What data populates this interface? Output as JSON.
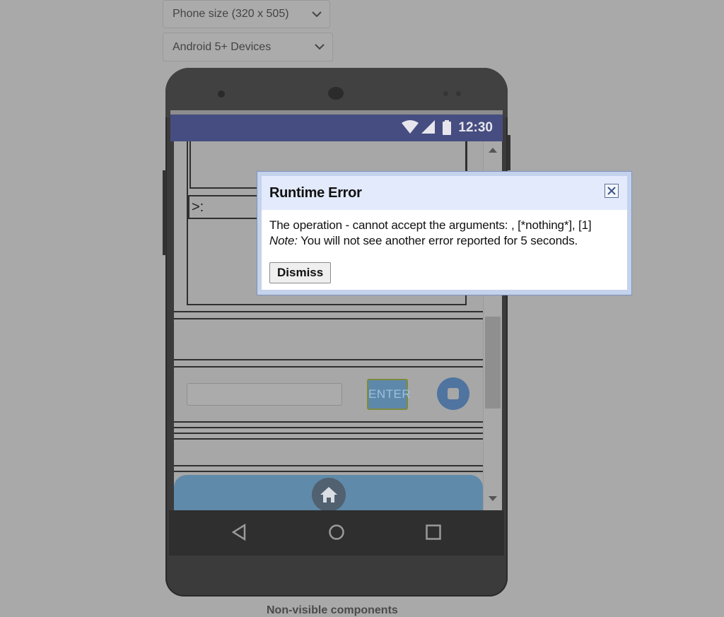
{
  "selects": {
    "phone_size": "Phone size (320 x 505)",
    "device": "Android 5+ Devices"
  },
  "statusbar": {
    "time": "12:30"
  },
  "app": {
    "prompt_text": ">:",
    "enter_label": "ENTER"
  },
  "dialog": {
    "title": "Runtime Error",
    "message": "The operation - cannot accept the arguments: , [*nothing*], [1]",
    "note_label": "Note:",
    "note_text": "You will not see another error reported for 5 seconds.",
    "dismiss_label": "Dismiss"
  },
  "footer": {
    "nonvisible_label": "Non-visible components"
  },
  "colors": {
    "background": "#a9a9a9",
    "statusbar": "#464d80",
    "dialog_header": "#e2eafb",
    "button_blue": "#5f8aaa"
  },
  "icons": [
    "chevron-down-icon",
    "wifi-icon",
    "signal-icon",
    "battery-icon",
    "close-icon",
    "stop-icon",
    "home-icon",
    "back-icon",
    "home-circle-icon",
    "recents-icon",
    "scroll-up-icon",
    "scroll-down-icon"
  ]
}
